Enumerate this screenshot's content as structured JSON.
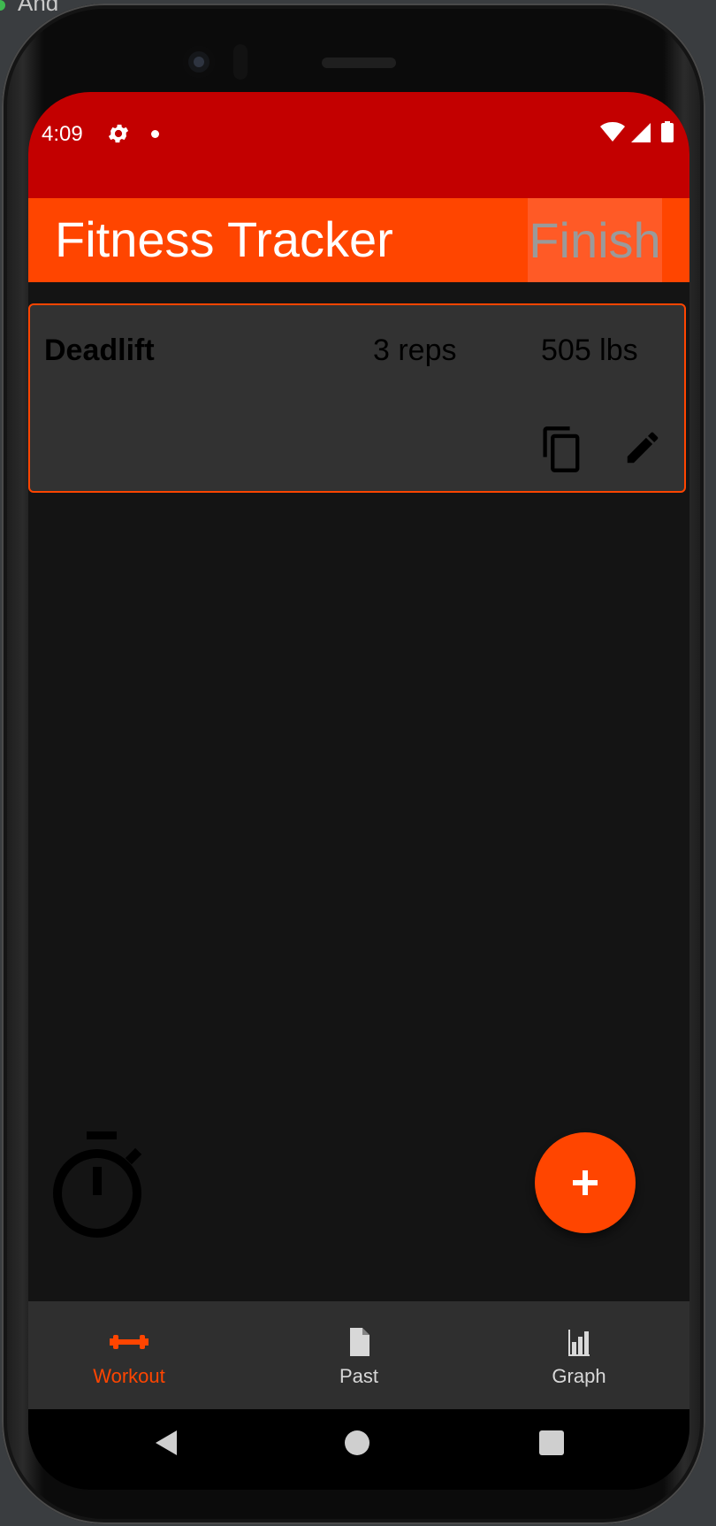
{
  "host_window": {
    "title": "And"
  },
  "status_bar": {
    "time": "4:09"
  },
  "app_bar": {
    "title": "Fitness Tracker",
    "finish_label": "Finish"
  },
  "workout": {
    "entries": [
      {
        "exercise": "Deadlift",
        "reps": "3 reps",
        "weight": "505 lbs"
      }
    ]
  },
  "fab": {
    "label": "+"
  },
  "bottom_nav": {
    "items": [
      {
        "label": "Workout",
        "icon": "dumbbell-icon",
        "active": true
      },
      {
        "label": "Past",
        "icon": "document-icon",
        "active": false
      },
      {
        "label": "Graph",
        "icon": "bar-chart-icon",
        "active": false
      }
    ]
  },
  "colors": {
    "status_bar": "#c30000",
    "accent": "#ff4500",
    "background": "#141414",
    "card": "#323232",
    "nav": "#2f2f2f"
  }
}
